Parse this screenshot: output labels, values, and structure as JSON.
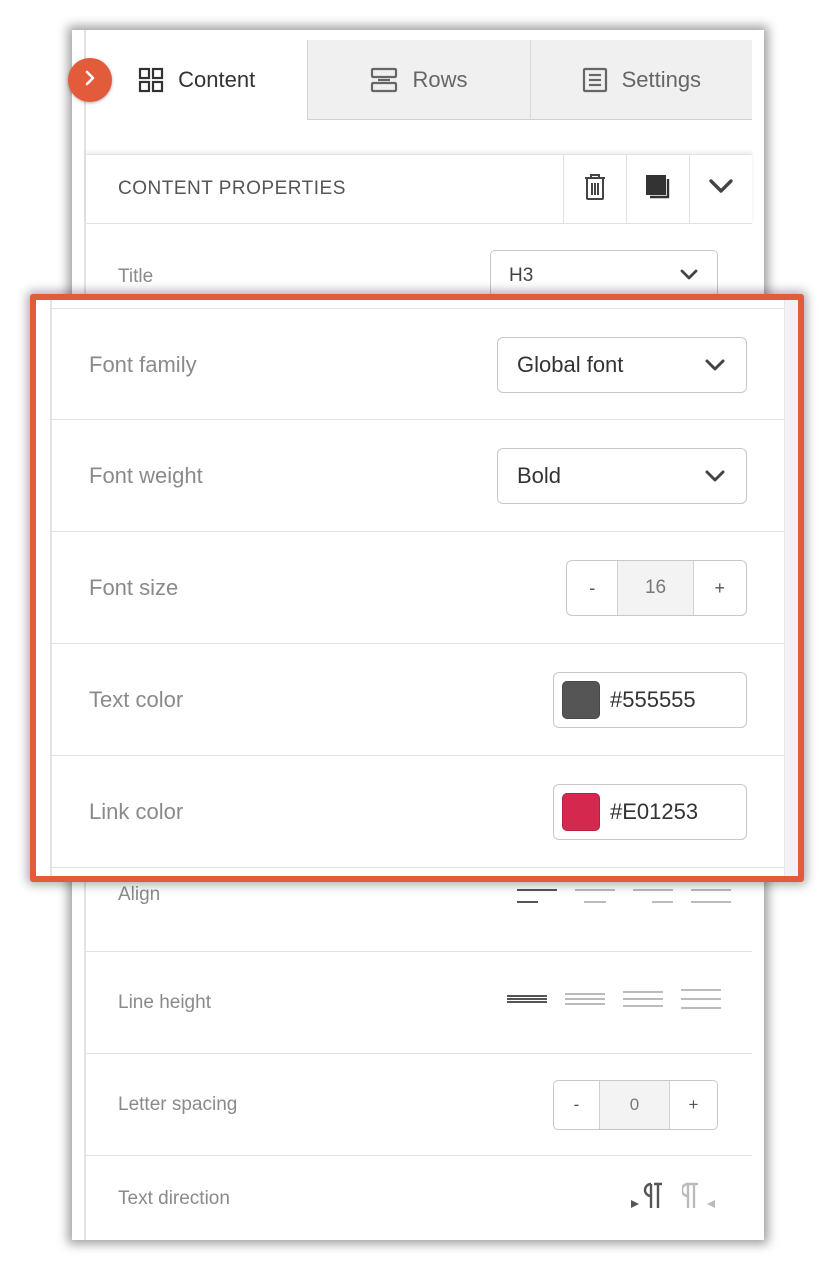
{
  "tabs": [
    {
      "label": "Content",
      "icon": "grid-icon",
      "active": true
    },
    {
      "label": "Rows",
      "icon": "rows-icon",
      "active": false
    },
    {
      "label": "Settings",
      "icon": "settings-list-icon",
      "active": false
    }
  ],
  "properties": {
    "header": "CONTENT PROPERTIES",
    "title_label": "Title",
    "title_value": "H3",
    "font_family_label": "Font family",
    "font_family_value": "Global font",
    "font_weight_label": "Font weight",
    "font_weight_value": "Bold",
    "font_size_label": "Font size",
    "font_size_value": "16",
    "text_color_label": "Text color",
    "text_color_value": "#555555",
    "link_color_label": "Link color",
    "link_color_value": "#E01253",
    "align_label": "Align",
    "line_height_label": "Line height",
    "letter_spacing_label": "Letter spacing",
    "letter_spacing_value": "0",
    "text_direction_label": "Text direction",
    "minus": "-",
    "plus": "+"
  },
  "colors": {
    "accent": "#e25c3b",
    "text_color_swatch": "#555555",
    "link_color_swatch": "#d4284f"
  }
}
